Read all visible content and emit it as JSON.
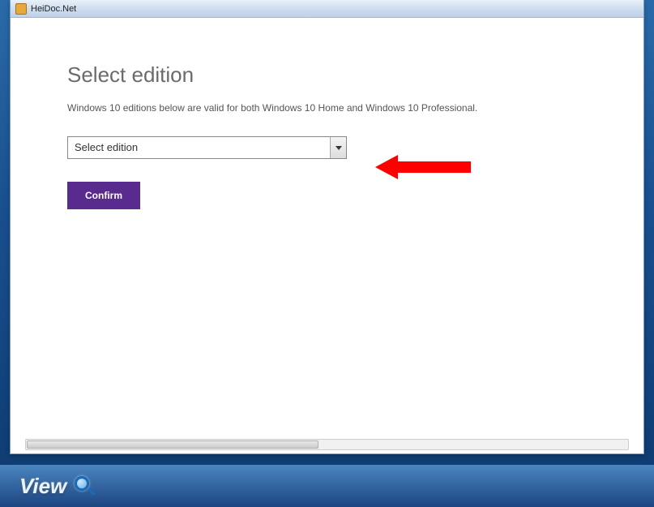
{
  "window": {
    "title": "HeiDoc.Net"
  },
  "page": {
    "heading": "Select edition",
    "description": "Windows 10 editions below are valid for both Windows 10 Home and Windows 10 Professional.",
    "select_placeholder": "Select edition",
    "confirm_label": "Confirm"
  },
  "bottom": {
    "view_label": "View"
  },
  "annotation": {
    "arrow_color": "#ff0000"
  }
}
